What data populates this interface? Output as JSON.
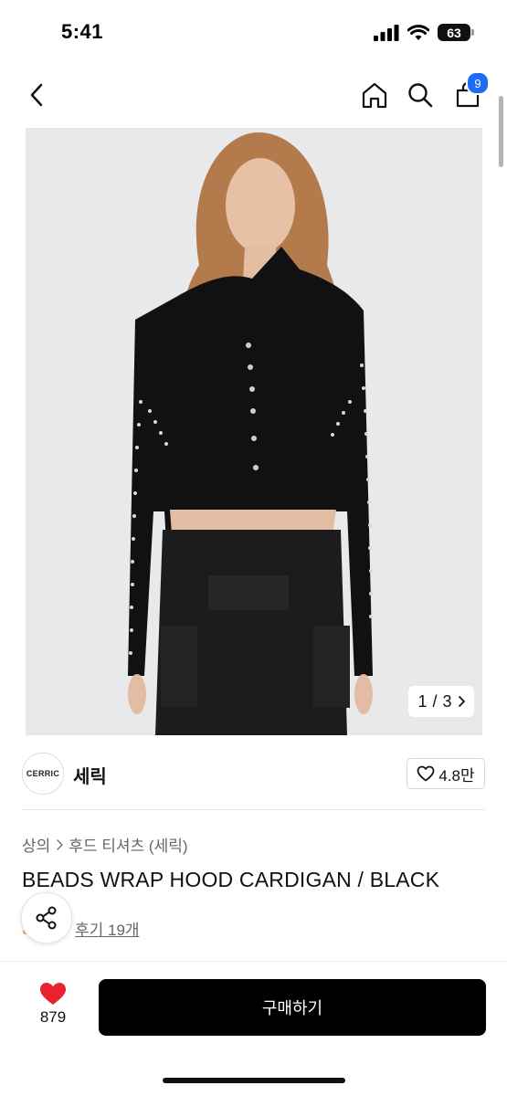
{
  "status": {
    "time": "5:41",
    "battery": "63"
  },
  "nav": {
    "cart_count": "9"
  },
  "gallery": {
    "current": "1",
    "separator": "/",
    "total": "3"
  },
  "brand": {
    "logo_text": "CERRIC",
    "name": "세릭",
    "likes": "4.8만"
  },
  "breadcrumb": {
    "category": "상의",
    "subcategory": "후드 티셔츠 (세릭)"
  },
  "product": {
    "title": "BEADS WRAP HOOD CARDIGAN / BLACK",
    "reviews": "후기 19개"
  },
  "bottom": {
    "like_count": "879",
    "buy_label": "구매하기"
  },
  "colors": {
    "accent": "#1e6cf3",
    "heart": "#e8232f",
    "button": "#000000"
  }
}
